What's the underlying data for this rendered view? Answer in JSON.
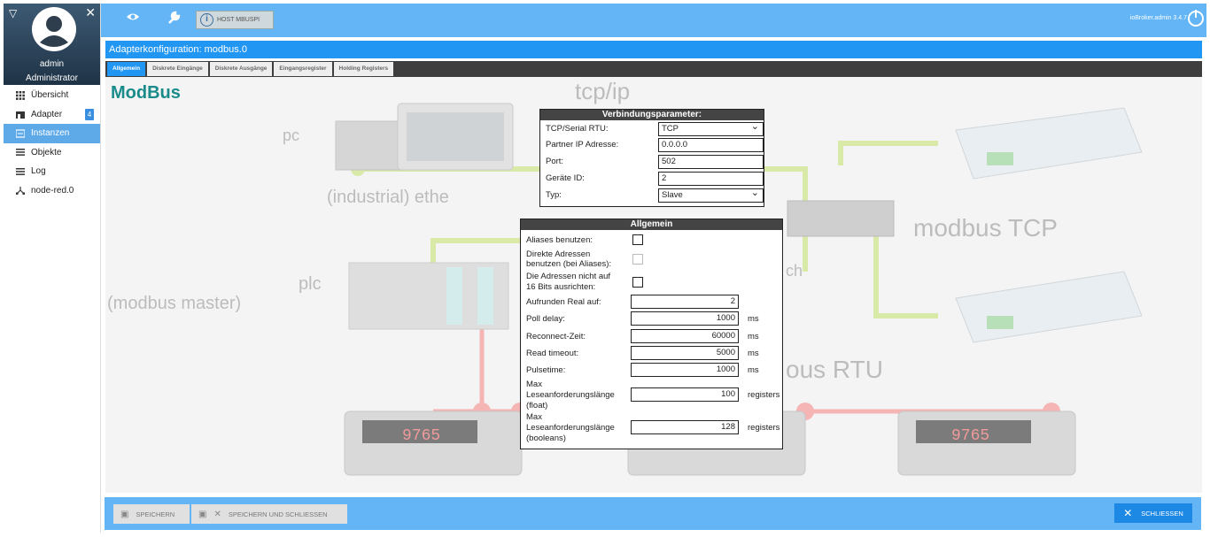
{
  "sidebar": {
    "user": {
      "name": "admin",
      "role": "Administrator"
    },
    "items": [
      {
        "label": "Übersicht",
        "icon": "grid-icon"
      },
      {
        "label": "Adapter",
        "icon": "store-icon",
        "badge": "4"
      },
      {
        "label": "Instanzen",
        "icon": "instances-icon"
      },
      {
        "label": "Objekte",
        "icon": "list-icon"
      },
      {
        "label": "Log",
        "icon": "log-icon"
      },
      {
        "label": "node-red.0",
        "icon": "network-icon"
      }
    ]
  },
  "topbar": {
    "host_label": "HOST MBUSPI",
    "version": "ioBroker.admin 3.4.7"
  },
  "page": {
    "title": "Adapterkonfiguration: modbus.0",
    "brand": "ModBus"
  },
  "tabs": [
    {
      "label": "Allgemein",
      "active": true
    },
    {
      "label": "Diskrete Eingänge"
    },
    {
      "label": "Diskrete Ausgänge"
    },
    {
      "label": "Eingangsregister"
    },
    {
      "label": "Holding Registers"
    }
  ],
  "background_labels": {
    "tcpip": "tcp/ip",
    "pc": "pc",
    "ethernet": "(industrial) ethe",
    "modbus_tcp": "modbus TCP",
    "plc": "plc",
    "modbus_master": "(modbus master)",
    "switch_frag": "ch",
    "modbus_rtu": "ous RTU",
    "display": "9765"
  },
  "connection": {
    "header": "Verbindungsparameter:",
    "fields": [
      {
        "label": "TCP/Serial RTU:",
        "value": "TCP"
      },
      {
        "label": "Partner IP Adresse:",
        "value": "0.0.0.0"
      },
      {
        "label": "Port:",
        "value": "502"
      },
      {
        "label": "Geräte ID:",
        "value": "2"
      },
      {
        "label": "Typ:",
        "value": "Slave"
      }
    ]
  },
  "general": {
    "header": "Allgemein",
    "aliases_label": "Aliases benutzen:",
    "direct_label_1": "Direkte Adressen",
    "direct_label_2": "benutzen (bei Aliases):",
    "align_label_1": "Die Adressen nicht auf",
    "align_label_2": "16 Bits ausrichten:",
    "fields": [
      {
        "label": "Aufrunden Real auf:",
        "value": "2",
        "unit": ""
      },
      {
        "label": "Poll delay:",
        "value": "1000",
        "unit": "ms"
      },
      {
        "label": "Reconnect-Zeit:",
        "value": "60000",
        "unit": "ms"
      },
      {
        "label": "Read timeout:",
        "value": "5000",
        "unit": "ms"
      },
      {
        "label": "Pulsetime:",
        "value": "1000",
        "unit": "ms"
      }
    ],
    "max_float": {
      "l1": "Max",
      "l2": "Leseanforderungslänge",
      "l3": "(float)",
      "value": "100",
      "unit": "registers"
    },
    "max_bool": {
      "l1": "Max",
      "l2": "Leseanforderungslänge",
      "l3": "(booleans)",
      "value": "128",
      "unit": "registers"
    }
  },
  "bottombar": {
    "save": "SPEICHERN",
    "save_close": "SPEICHERN UND SCHLIESSEN",
    "close": "SCHLIESSEN"
  }
}
